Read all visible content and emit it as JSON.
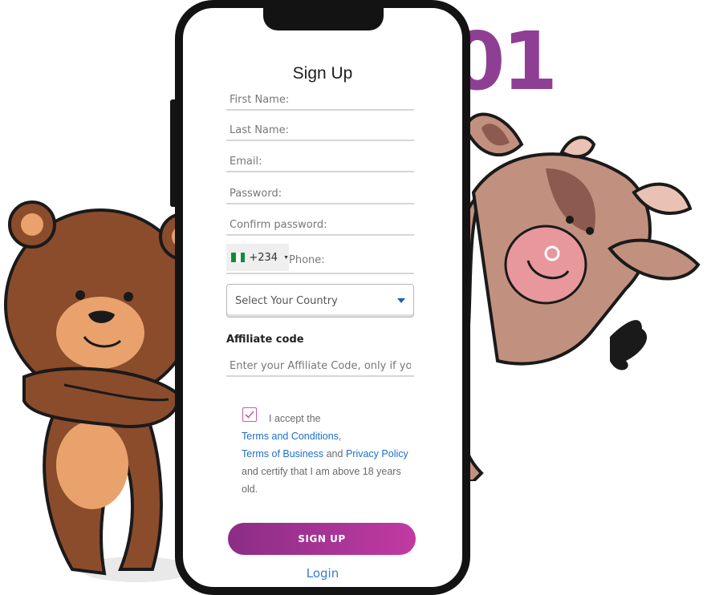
{
  "background": {
    "logo_text": "01",
    "accent_color": "#8e3f94"
  },
  "form": {
    "title": "Sign Up",
    "first_name_placeholder": "First Name:",
    "last_name_placeholder": "Last Name:",
    "email_placeholder": "Email:",
    "password_placeholder": "Password:",
    "confirm_password_placeholder": "Confirm password:",
    "phone": {
      "country_code": "+234",
      "placeholder": "Phone:"
    },
    "country_select": {
      "selected": "Select Your Country"
    },
    "affiliate": {
      "label": "Affiliate code",
      "placeholder": "Enter your Affiliate Code, only if you ha"
    },
    "terms": {
      "prefix": "I accept the",
      "terms_link": "Terms and Conditions",
      "comma": ",",
      "business_link": "Terms of Business",
      "and_text": "and",
      "privacy_link": "Privacy Policy",
      "suffix": "and certify that I am above 18 years old."
    },
    "checkbox_checked": true,
    "signup_button": "SIGN UP",
    "login_link": "Login"
  },
  "colors": {
    "button_start": "#8b2d86",
    "button_end": "#c13aa3",
    "link": "#1f6fc5"
  }
}
